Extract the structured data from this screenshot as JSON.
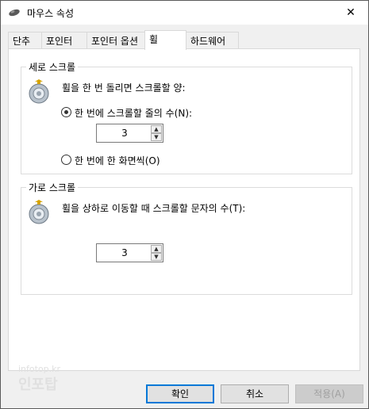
{
  "window": {
    "title": "마우스 속성",
    "close_glyph": "✕"
  },
  "tabs": [
    {
      "label": "단추"
    },
    {
      "label": "포인터"
    },
    {
      "label": "포인터 옵션"
    },
    {
      "label": "휠"
    },
    {
      "label": "하드웨어"
    }
  ],
  "active_tab": "휠",
  "vertical": {
    "title": "세로 스크롤",
    "description": "휠을 한 번 돌리면 스크롤할 양:",
    "option_lines": "한 번에 스크롤할 줄의 수(N):",
    "lines_value": "3",
    "option_screen": "한 번에 한 화면씩(O)",
    "selected": "lines"
  },
  "horizontal": {
    "title": "가로 스크롤",
    "description": "휠을 상하로 이동할 때 스크롤할 문자의 수(T):",
    "chars_value": "3"
  },
  "watermark": {
    "line1": "infotop.kr",
    "line2": "인포탑"
  },
  "buttons": {
    "ok": "확인",
    "cancel": "취소",
    "apply": "적용(A)"
  },
  "icons": {
    "app": "mouse-icon",
    "wheel": "mouse-wheel-icon",
    "close": "close-icon"
  }
}
